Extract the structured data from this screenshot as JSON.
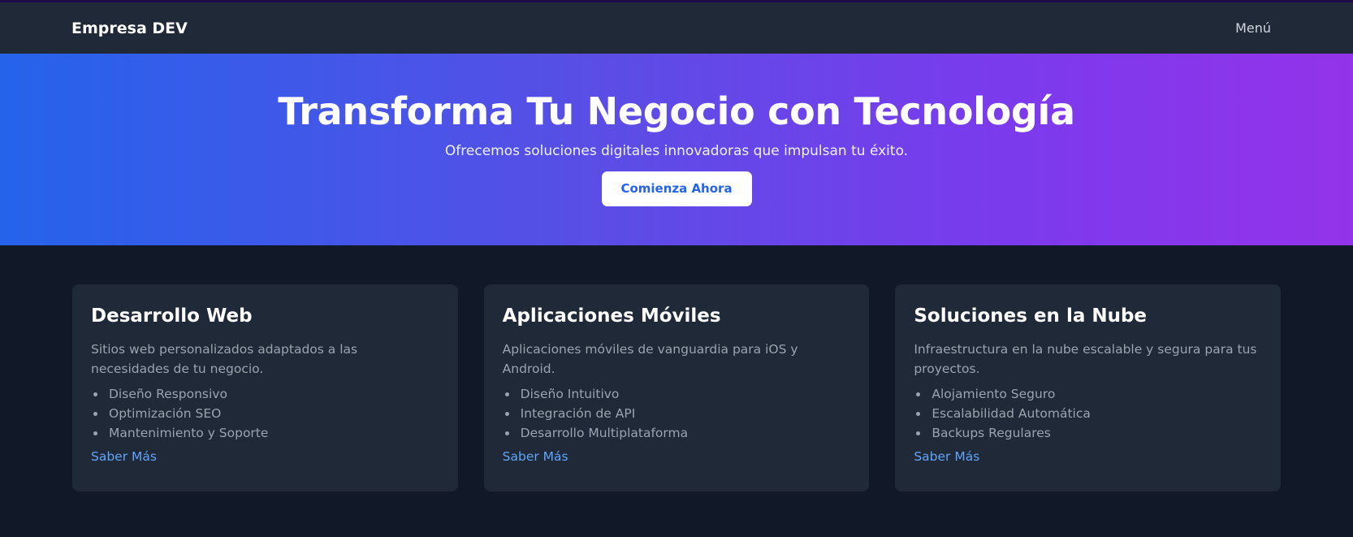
{
  "navbar": {
    "brand": "Empresa DEV",
    "menu_label": "Menú"
  },
  "hero": {
    "title": "Transforma Tu Negocio con Tecnología",
    "subtitle": "Ofrecemos soluciones digitales innovadoras que impulsan tu éxito.",
    "cta_label": "Comienza Ahora"
  },
  "services": [
    {
      "title": "Desarrollo Web",
      "description": "Sitios web personalizados adaptados a las necesidades de tu negocio.",
      "features": [
        "Diseño Responsivo",
        "Optimización SEO",
        "Mantenimiento y Soporte"
      ],
      "link_label": "Saber Más"
    },
    {
      "title": "Aplicaciones Móviles",
      "description": "Aplicaciones móviles de vanguardia para iOS y Android.",
      "features": [
        "Diseño Intuitivo",
        "Integración de API",
        "Desarrollo Multiplataforma"
      ],
      "link_label": "Saber Más"
    },
    {
      "title": "Soluciones en la Nube",
      "description": "Infraestructura en la nube escalable y segura para tus proyectos.",
      "features": [
        "Alojamiento Seguro",
        "Escalabilidad Automática",
        "Backups Regulares"
      ],
      "link_label": "Saber Más"
    }
  ],
  "colors": {
    "background": "#111827",
    "navbar": "#1f2937",
    "card": "#1f2937",
    "accent": "#2563eb",
    "link": "#60a5fa",
    "hero_gradient_start": "#2563eb",
    "hero_gradient_end": "#9333ea"
  }
}
